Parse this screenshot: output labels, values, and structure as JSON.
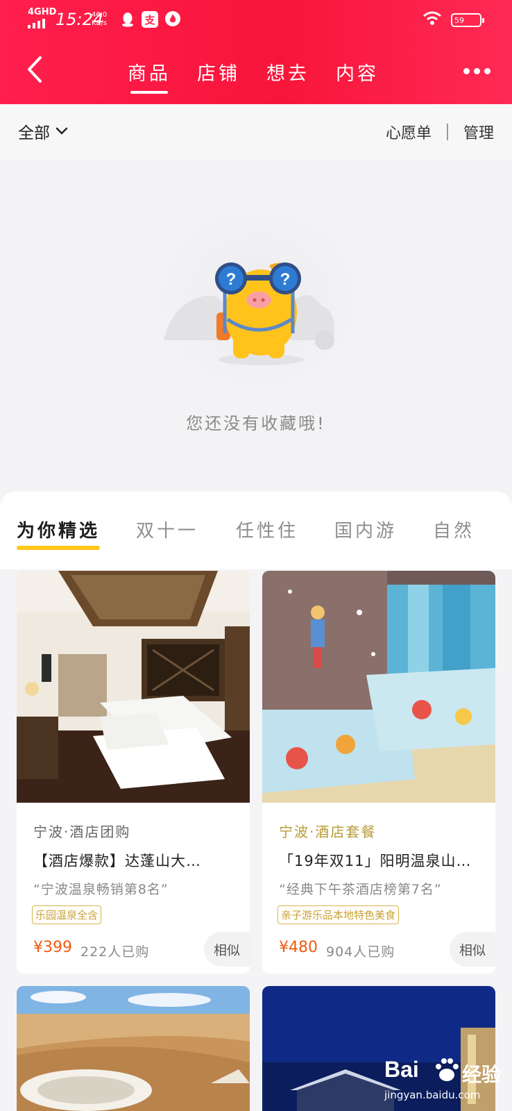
{
  "status_bar": {
    "network": "4GHD",
    "time": "15:24",
    "speed_value": "46.0",
    "speed_unit": "KB/s",
    "battery": "59"
  },
  "header": {
    "tabs": [
      "商品",
      "店铺",
      "想去",
      "内容"
    ],
    "active_tab": 0
  },
  "filter_bar": {
    "all_label": "全部",
    "wishlist_label": "心愿单",
    "manage_label": "管理"
  },
  "empty_state": {
    "message": "您还没有收藏哦!"
  },
  "category_tabs": {
    "items": [
      "为你精选",
      "双十一",
      "任性住",
      "国内游",
      "自然"
    ],
    "active": 0
  },
  "cards": [
    {
      "location": "宁波·酒店团购",
      "title": "【酒店爆款】达蓬山大…",
      "quote": "“宁波温泉畅销第8名”",
      "tag": "乐园温泉全含",
      "price": "¥399",
      "sold": "222人已购",
      "similar": "相似"
    },
    {
      "location": "宁波·酒店套餐",
      "title": "「19年双11」阳明温泉山…",
      "quote": "“经典下午茶酒店榜第7名”",
      "tag": "亲子游乐品本地特色美食",
      "price": "¥480",
      "sold": "904人已购",
      "similar": "相似"
    }
  ],
  "watermark": {
    "brand": "Bai",
    "brand_cn": "经验",
    "url": "jingyan.baidu.com"
  },
  "colors": {
    "header_red": "#f8153a",
    "accent_yellow": "#ffc718",
    "price_orange": "#f05a14",
    "tag_gold": "#c9a233"
  }
}
